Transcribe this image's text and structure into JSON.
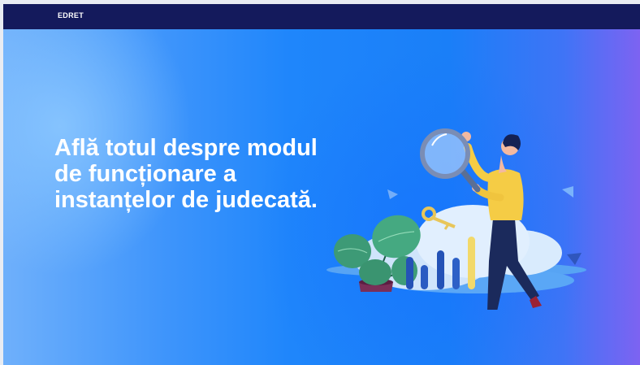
{
  "header": {
    "logo_text": "EDRET"
  },
  "hero": {
    "headline": "Află totul despre modul de funcționare a instanțelor de judecată."
  },
  "colors": {
    "topbar": "#141a5c",
    "gradient_start": "#6fb0fb",
    "gradient_mid": "#1f86fb",
    "gradient_end": "#7d63f2"
  },
  "illustration": {
    "icons": [
      "magnifier-icon",
      "key-icon",
      "bar-chart-icon",
      "plant-icon",
      "person-figure"
    ]
  }
}
